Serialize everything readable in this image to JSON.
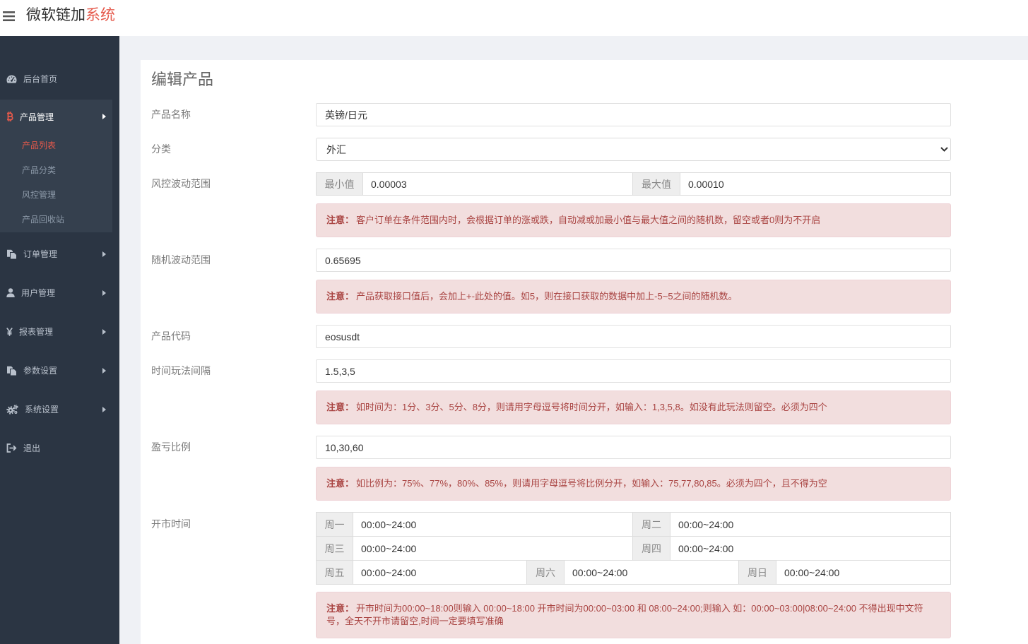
{
  "header": {
    "title": "微软链加",
    "title_suffix": "系统"
  },
  "colors": {
    "accent": "#e5594b",
    "sidebar_bg": "#2b3543",
    "sidebar_active_bg": "#35404e",
    "alert_bg": "#f2dede",
    "alert_text": "#a94442"
  },
  "sidebar": {
    "items": [
      {
        "label": "后台首页",
        "icon": "dashboard-icon"
      },
      {
        "label": "产品管理",
        "icon": "bitcoin-icon",
        "active": true,
        "children": [
          {
            "label": "产品列表",
            "active": true
          },
          {
            "label": "产品分类"
          },
          {
            "label": "风控管理"
          },
          {
            "label": "产品回收站"
          }
        ]
      },
      {
        "label": "订单管理",
        "icon": "files-icon"
      },
      {
        "label": "用户管理",
        "icon": "user-icon"
      },
      {
        "label": "报表管理",
        "icon": "yen-icon"
      },
      {
        "label": "参数设置",
        "icon": "files-icon"
      },
      {
        "label": "系统设置",
        "icon": "cogs-icon"
      },
      {
        "label": "退出",
        "icon": "sign-out-icon"
      }
    ]
  },
  "page": {
    "title": "编辑产品"
  },
  "form": {
    "note_prefix": "注意：",
    "name": {
      "label": "产品名称",
      "value": "英镑/日元"
    },
    "category": {
      "label": "分类",
      "selected": "外汇"
    },
    "risk_range": {
      "label": "风控波动范围",
      "min_label": "最小值",
      "min_value": "0.00003",
      "max_label": "最大值",
      "max_value": "0.00010",
      "note": "客户订单在条件范围内时，会根据订单的涨或跌，自动减或加最小值与最大值之间的随机数，留空或者0则为不开启"
    },
    "random_range": {
      "label": "随机波动范围",
      "value": "0.65695",
      "note": "产品获取接口值后，会加上+-此处的值。如5，则在接口获取的数据中加上-5~5之间的随机数。"
    },
    "code": {
      "label": "产品代码",
      "value": "eosusdt"
    },
    "time_intervals": {
      "label": "时间玩法间隔",
      "value": "1.5,3,5",
      "note": "如时间为：1分、3分、5分、8分，则请用字母逗号将时间分开，如输入：1,3,5,8。如没有此玩法则留空。必须为四个"
    },
    "profit_ratio": {
      "label": "盈亏比例",
      "value": "10,30,60",
      "note": "如比例为：75%、77%，80%、85%，则请用字母逗号将比例分开，如输入：75,77,80,85。必须为四个，且不得为空"
    },
    "market_hours": {
      "label": "开市时间",
      "days": [
        {
          "label": "周一",
          "value": "00:00~24:00"
        },
        {
          "label": "周二",
          "value": "00:00~24:00"
        },
        {
          "label": "周三",
          "value": "00:00~24:00"
        },
        {
          "label": "周四",
          "value": "00:00~24:00"
        },
        {
          "label": "周五",
          "value": "00:00~24:00"
        },
        {
          "label": "周六",
          "value": "00:00~24:00"
        },
        {
          "label": "周日",
          "value": "00:00~24:00"
        }
      ],
      "note": "开市时间为00:00~18:00则输入 00:00~18:00 开市时间为00:00~03:00 和 08:00~24:00;则输入 如：00:00~03:00|08:00~24:00 不得出现中文符号，全天不开市请留空,时间一定要填写准确"
    }
  }
}
